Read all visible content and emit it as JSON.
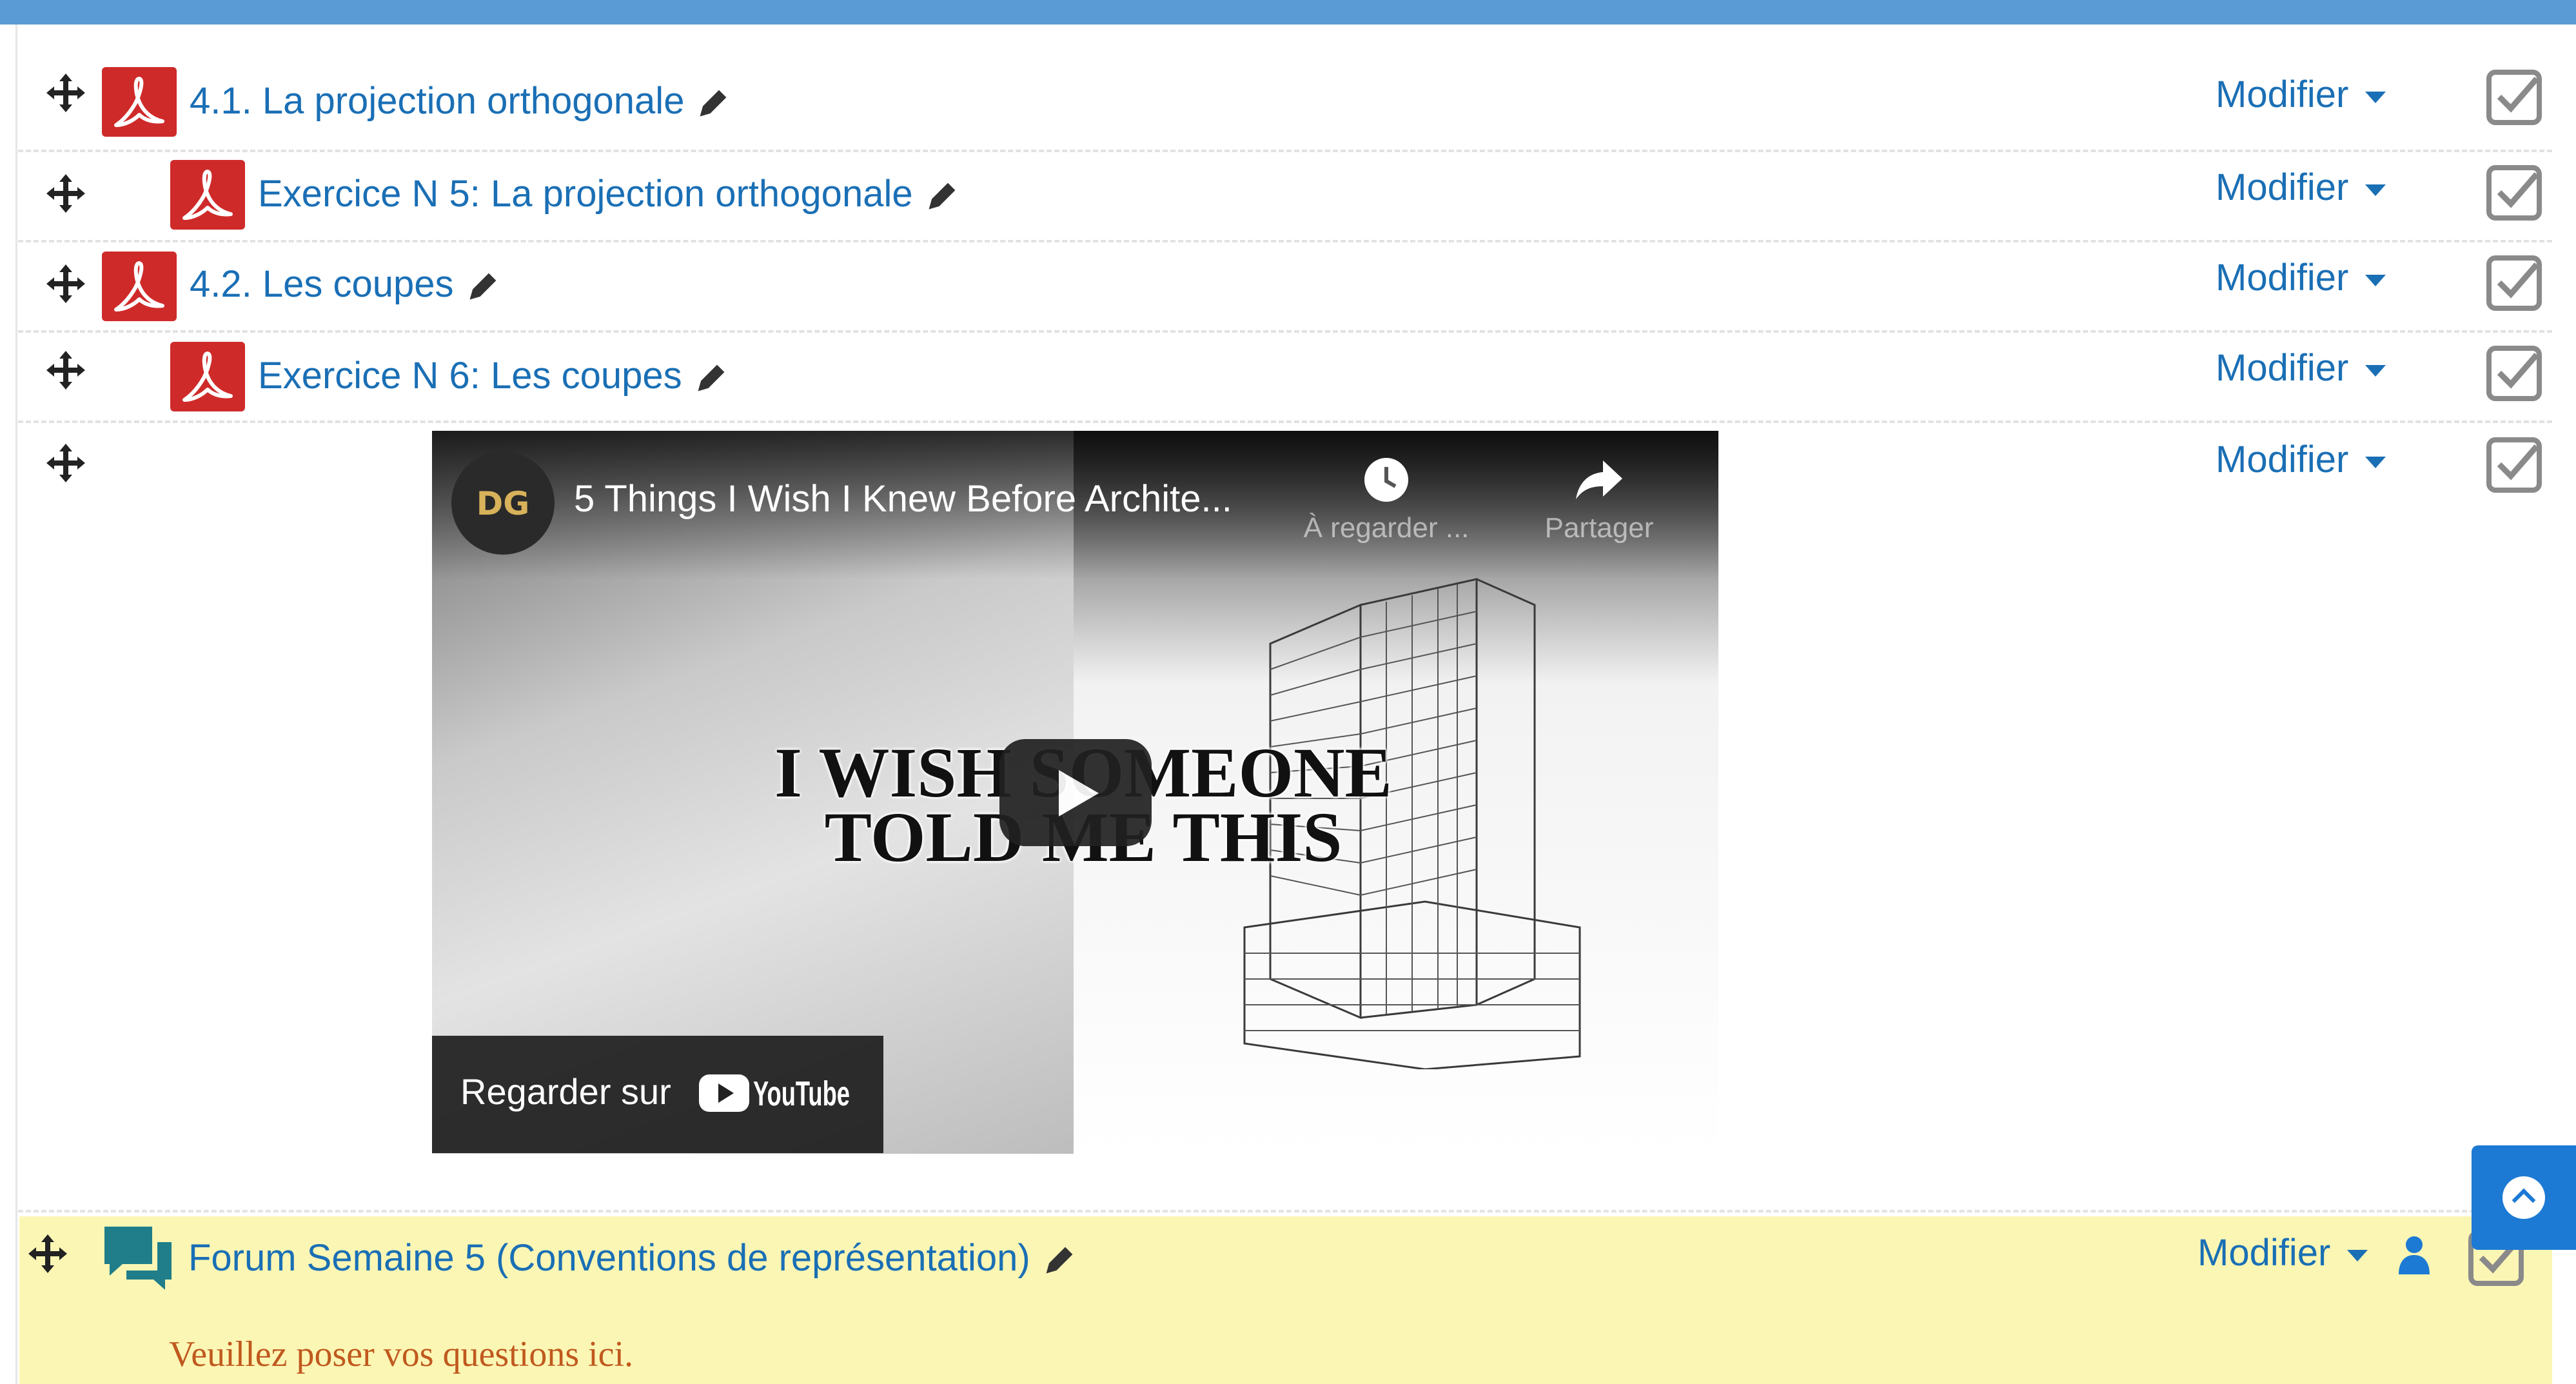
{
  "colors": {
    "link": "#1a6fb5",
    "pdf": "#cf2a2a",
    "forum_bg": "#fbf6b4",
    "forum_desc": "#c0591e",
    "accent": "#1c7ad4"
  },
  "activities": [
    {
      "title": "4.1. La projection orthogonale",
      "icon": "pdf-icon",
      "modify": "Modifier"
    },
    {
      "title": "Exercice N 5: La projection orthogonale",
      "icon": "pdf-icon",
      "modify": "Modifier"
    },
    {
      "title": "4.2. Les coupes",
      "icon": "pdf-icon",
      "modify": "Modifier"
    },
    {
      "title": "Exercice N 6: Les coupes",
      "icon": "pdf-icon",
      "modify": "Modifier"
    },
    {
      "modify": "Modifier"
    }
  ],
  "video": {
    "channel_logo": "DG",
    "title": "5 Things I Wish I Knew Before Archite...",
    "watch_later": "À regarder ...",
    "share": "Partager",
    "overlay_line1": "I WISH SOMEONE",
    "overlay_line2": "TOLD ME THIS",
    "watch_on": "Regarder sur",
    "youtube": "YouTube"
  },
  "forum": {
    "title": "Forum Semaine 5 (Conventions de représentation)",
    "modify": "Modifier",
    "description": "Veuillez poser vos questions ici."
  }
}
